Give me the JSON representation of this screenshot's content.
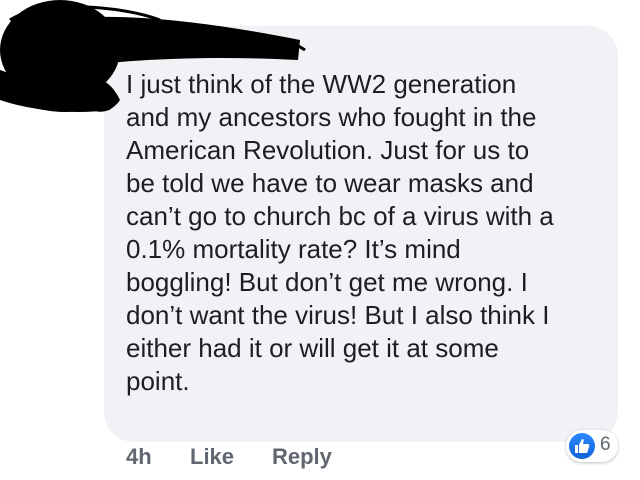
{
  "comment": {
    "lines": [
      "I just think of the WW2 generation",
      "and my ancestors who fought in the",
      "American Revolution. Just for us to",
      "be told we have to wear masks and",
      "can’t go to church bc of a virus with a",
      "0.1% mortality rate? It’s mind",
      "boggling! But don’t get me wrong. I",
      "don’t want the virus! But I also think I",
      "either had it or will get it at some",
      "point."
    ]
  },
  "actions": {
    "timestamp": "4h",
    "like_label": "Like",
    "reply_label": "Reply"
  },
  "reactions": {
    "icon": "thumbs-up-icon",
    "count": "6",
    "color": "#1877f2"
  },
  "colors": {
    "bubble": "#f0f2f5",
    "text": "#1c1e21",
    "meta": "#606770",
    "redaction": "#000000"
  }
}
